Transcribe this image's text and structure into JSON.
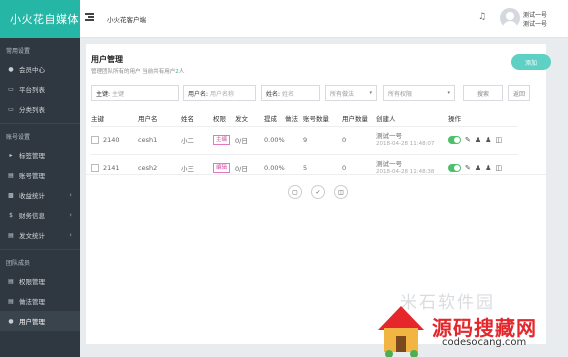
{
  "app": {
    "brand": "小火花自媒体",
    "top_title": "小火花客户端"
  },
  "user": {
    "line1": "测试一号",
    "line2": "测试一号"
  },
  "sidebar": {
    "sections": [
      {
        "title": "常用设置",
        "items": [
          {
            "label": "会员中心",
            "icon": "person-icon"
          },
          {
            "label": "平台列表",
            "icon": "monitor-icon"
          },
          {
            "label": "分类列表",
            "icon": "monitor-icon"
          }
        ]
      },
      {
        "title": "账号设置",
        "items": [
          {
            "label": "标签管理",
            "icon": "tag-icon"
          },
          {
            "label": "账号管理",
            "icon": "doc-icon"
          },
          {
            "label": "收益统计",
            "icon": "chart-icon"
          },
          {
            "label": "财务信息",
            "icon": "dollar-icon"
          },
          {
            "label": "发文统计",
            "icon": "stats-icon"
          }
        ]
      },
      {
        "title": "团队成员",
        "items": [
          {
            "label": "权限管理",
            "icon": "doc-icon"
          },
          {
            "label": "做法管理",
            "icon": "doc-icon"
          },
          {
            "label": "用户管理",
            "icon": "person-icon"
          }
        ]
      }
    ]
  },
  "page": {
    "title": "用户管理",
    "subtitle_prefix": "管理团队所有的用户  当前共有用户",
    "subtitle_count": "2",
    "subtitle_suffix": "人",
    "add_label": "添加"
  },
  "filters": {
    "id_label": "主键:",
    "id_placeholder": "主键",
    "username_label": "用户名:",
    "username_placeholder": "用户名称",
    "name_label": "姓名:",
    "name_placeholder": "姓名",
    "method_select": "所有做法",
    "perm_select": "所有权限",
    "search_label": "搜索",
    "back_label": "返回"
  },
  "table": {
    "headers": [
      "主键",
      "用户名",
      "姓名",
      "权限",
      "发文",
      "提成",
      "做法",
      "账号数量",
      "用户数量",
      "创建人",
      "操作"
    ],
    "rows": [
      {
        "id": "2140",
        "username": "cesh1",
        "name": "小二",
        "perm": "主编",
        "posts": "0/日",
        "commission": "0.00%",
        "method": "",
        "accounts": "9",
        "users": "0",
        "creator": "测试一号",
        "created": "2018-04-28 11:48:07"
      },
      {
        "id": "2141",
        "username": "cesh2",
        "name": "小三",
        "perm": "编辑",
        "posts": "0/日",
        "commission": "0.00%",
        "method": "",
        "accounts": "5",
        "users": "0",
        "creator": "测试一号",
        "created": "2018-04-28 11:48:38"
      }
    ]
  },
  "watermark": {
    "gray": "米石软件园",
    "red": "源码搜藏网",
    "url": "codesocang.com"
  }
}
